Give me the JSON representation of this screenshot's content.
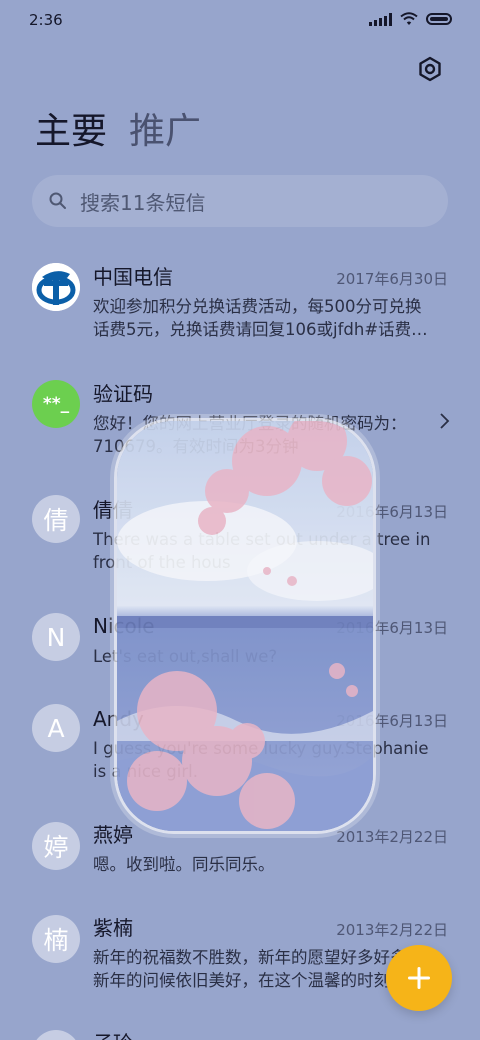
{
  "status_bar": {
    "time": "2:36"
  },
  "tabs": [
    {
      "label": "主要"
    },
    {
      "label": "推广"
    }
  ],
  "search": {
    "placeholder": "搜索11条短信"
  },
  "messages": [
    {
      "name": "中国电信",
      "date": "2017年6月30日",
      "preview": "欢迎参加积分兑换话费活动，每500分可兑换\n话费5元，兑换话费请回复106或jfdh#话费…",
      "avatar": "china-telecom-logo"
    },
    {
      "name": "验证码",
      "date": "",
      "preview": "您好！您的网上营业厅登录的随机密码为：\n710679。有效时间为3分钟",
      "avatar_text": "**_"
    },
    {
      "name": "倩倩",
      "date": "2016年6月13日",
      "preview": "There was a table set out under a tree in\nfront of the hous",
      "avatar_text": "倩"
    },
    {
      "name": "Nicole",
      "date": "2016年6月13日",
      "preview": "Let's eat out,shall we?",
      "avatar_text": "N"
    },
    {
      "name": "Andy",
      "date": "2016年6月13日",
      "preview": "I guess you're some lucky guy.Stephanie\nis a nice girl.",
      "avatar_text": "A"
    },
    {
      "name": "燕婷",
      "date": "2013年2月22日",
      "preview": "嗯。收到啦。同乐同乐。",
      "avatar_text": "婷"
    },
    {
      "name": "紫楠",
      "date": "2013年2月22日",
      "preview": "新年的祝福数不胜数，新年的愿望好多好多，\n新年的问候依旧美好，在这个温馨的时刻",
      "avatar_text": "楠"
    },
    {
      "name": "子玲",
      "date": "",
      "preview": "",
      "avatar_text": ""
    }
  ],
  "colors": {
    "background": "#97a5cc",
    "fab": "#f6b418",
    "verification_avatar": "#6ccf4f",
    "telecom_blue": "#0b5fa8"
  },
  "icons": {
    "settings": "settings-icon",
    "search": "search-icon",
    "chevron": "chevron-right-icon",
    "fab": "plus-icon"
  }
}
